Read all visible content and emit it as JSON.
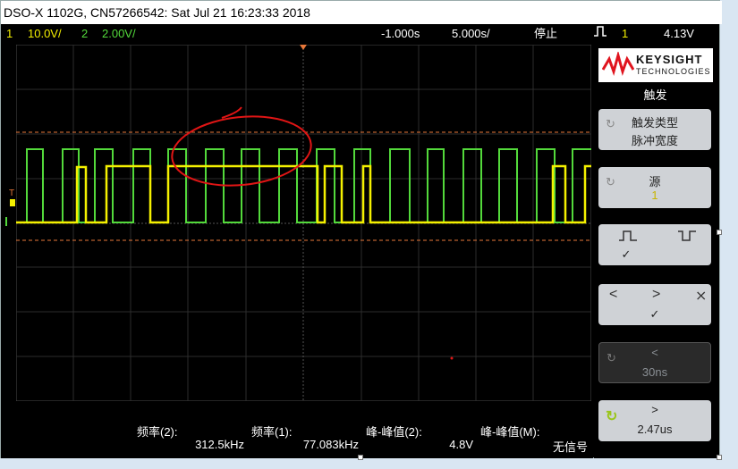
{
  "window": {
    "title": "DSO-X 1102G, CN57266542: Sat Jul 21 16:23:33 2018"
  },
  "status": {
    "ch1_num": "1",
    "ch1_scale": "10.0V/",
    "ch2_num": "2",
    "ch2_scale": "2.00V/",
    "delay": "-1.000s",
    "timebase": "5.000s/",
    "run_state": "停止",
    "trig_channel": "1",
    "trig_level": "4.13V"
  },
  "panel": {
    "brand": "KEYSIGHT",
    "brand_sub": "TECHNOLOGIES",
    "title": "触发",
    "trigger_type_label": "触发类型",
    "trigger_type_value": "脉冲宽度",
    "source_label": "源",
    "source_value": "1",
    "less_than_label": "<",
    "less_than_value": "30ns",
    "greater_than_label": ">",
    "greater_than_value": "2.47us",
    "check_mark": "✓"
  },
  "measurements": [
    {
      "title": "频率(2):",
      "value": "312.5kHz"
    },
    {
      "title": "频率(1):",
      "value": "77.083kHz"
    },
    {
      "title": "峰-峰值(2):",
      "value": "4.8V"
    },
    {
      "title": "峰-峰值(M):",
      "value": "无信号"
    }
  ],
  "colors": {
    "ch1": "#f4f000",
    "ch2": "#53d93b",
    "math": "#d66ad6",
    "annotation": "#e01515"
  },
  "icons": [
    "keysight-logo-icon",
    "rotate-knob-icon",
    "rising-pulse-icon",
    "falling-pulse-icon",
    "trigger-marker-icon"
  ]
}
